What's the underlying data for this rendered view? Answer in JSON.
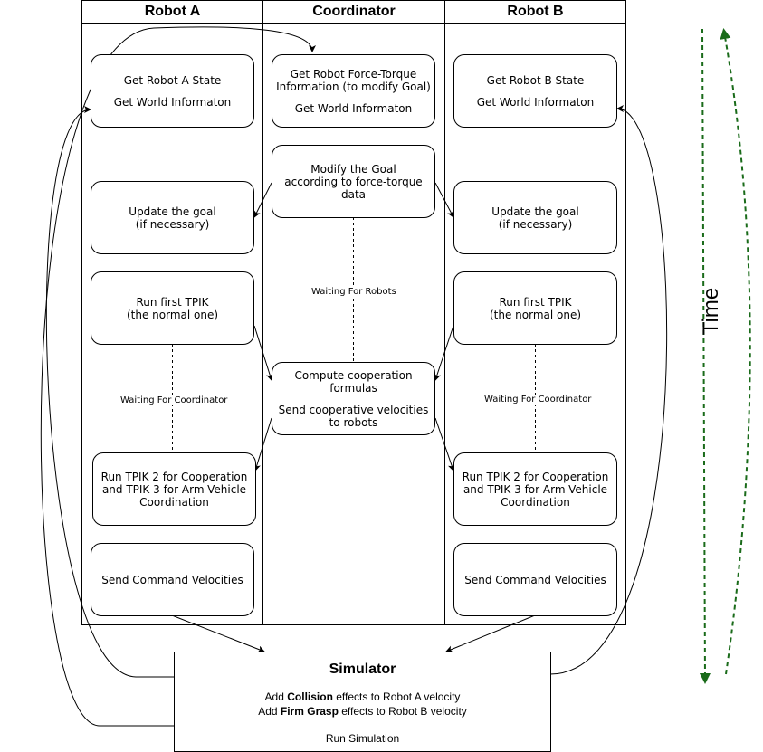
{
  "lanes": {
    "robot_a": "Robot A",
    "coordinator": "Coordinator",
    "robot_b": "Robot B"
  },
  "robot_a": {
    "state_1": "Get Robot A State",
    "state_2": "Get World Informaton",
    "update_1": "Update the goal",
    "update_2": "(if necessary)",
    "tpik1_1": "Run first TPIK",
    "tpik1_2": "(the normal one)",
    "tpik2_1": "Run TPIK 2 for Cooperation",
    "tpik2_2": "and TPIK 3 for Arm-Vehicle",
    "tpik2_3": "Coordination",
    "send": "Send Command Velocities",
    "wait": "Waiting For Coordinator"
  },
  "coordinator": {
    "ft_1": "Get Robot Force-Torque",
    "ft_2": "Information (to modify Goal)",
    "ft_3": "Get World Informaton",
    "mod_1": "Modify the Goal",
    "mod_2": "according to force-torque",
    "mod_3": "data",
    "coop_1": "Compute cooperation",
    "coop_2": "formulas",
    "coop_3": "Send cooperative velocities",
    "coop_4": "to robots",
    "wait": "Waiting For Robots"
  },
  "robot_b": {
    "state_1": "Get Robot B State",
    "state_2": "Get World Informaton",
    "update_1": "Update the goal",
    "update_2": "(if necessary)",
    "tpik1_1": "Run first TPIK",
    "tpik1_2": "(the normal one)",
    "tpik2_1": "Run TPIK 2 for Cooperation",
    "tpik2_2": "and TPIK 3 for Arm-Vehicle",
    "tpik2_3": "Coordination",
    "send": "Send Command Velocities",
    "wait": "Waiting For Coordinator"
  },
  "simulator": {
    "title": "Simulator",
    "l1_pre": "Add ",
    "l1_bold": "Collision",
    "l1_post": " effects to Robot A velocity",
    "l2_pre": "Add ",
    "l2_bold": "Firm Grasp",
    "l2_post": " effects to Robot B velocity",
    "l3": "Run Simulation"
  },
  "time_label": "Time",
  "colors": {
    "time_arrow": "#1a6b1a",
    "line": "#000000"
  }
}
